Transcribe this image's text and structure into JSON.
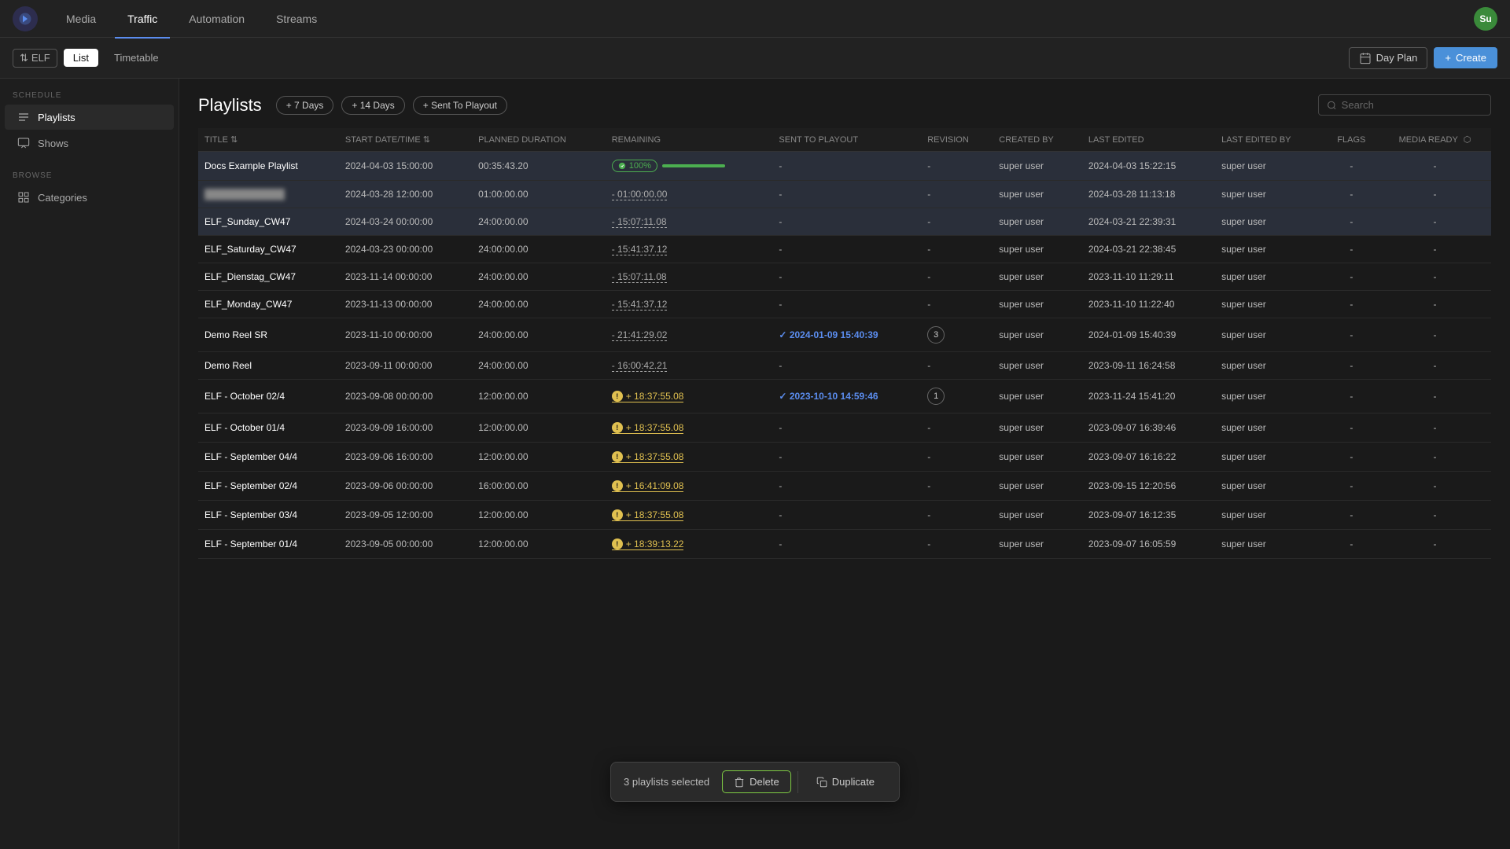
{
  "app": {
    "logo_text": "N"
  },
  "nav": {
    "items": [
      {
        "label": "Media",
        "active": false
      },
      {
        "label": "Traffic",
        "active": true
      },
      {
        "label": "Automation",
        "active": false
      },
      {
        "label": "Streams",
        "active": false
      }
    ],
    "user_initials": "Su",
    "user_bg": "#3a8a3a"
  },
  "toolbar": {
    "elf_label": "ELF",
    "list_label": "List",
    "timetable_label": "Timetable",
    "day_plan_label": "Day Plan",
    "create_label": "+ Create"
  },
  "sidebar": {
    "schedule_label": "SCHEDULE",
    "playlists_label": "Playlists",
    "shows_label": "Shows",
    "browse_label": "BROWSE",
    "categories_label": "Categories"
  },
  "playlists": {
    "title": "Playlists",
    "btn_7days": "+ 7 Days",
    "btn_14days": "+ 14 Days",
    "btn_sent": "+ Sent To Playout",
    "search_placeholder": "Search"
  },
  "table": {
    "columns": [
      "TITLE",
      "START DATE/TIME",
      "PLANNED DURATION",
      "REMAINING",
      "SENT TO PLAYOUT",
      "REVISION",
      "CREATED BY",
      "LAST EDITED",
      "LAST EDITED BY",
      "FLAGS",
      "MEDIA READY"
    ],
    "rows": [
      {
        "title": "Docs Example Playlist",
        "start": "2024-04-03 15:00:00",
        "planned": "00:35:43.20",
        "remaining_type": "progress",
        "remaining_pct": 100,
        "remaining_label": "100%",
        "sent_to_playout": "-",
        "revision": "-",
        "created_by": "super user",
        "last_edited": "2024-04-03 15:22:15",
        "last_edited_by": "super user",
        "flags": "-",
        "media_ready": "-",
        "selected": true
      },
      {
        "title": "",
        "title_blurred": true,
        "start": "2024-03-28 12:00:00",
        "planned": "01:00:00.00",
        "remaining_type": "undertime",
        "remaining_label": "- 01:00:00.00",
        "sent_to_playout": "-",
        "revision": "-",
        "created_by": "super user",
        "last_edited": "2024-03-28 11:13:18",
        "last_edited_by": "super user",
        "flags": "-",
        "media_ready": "-",
        "selected": true
      },
      {
        "title": "ELF_Sunday_CW47",
        "start": "2024-03-24 00:00:00",
        "planned": "24:00:00.00",
        "remaining_type": "undertime",
        "remaining_label": "- 15:07:11.08",
        "sent_to_playout": "-",
        "revision": "-",
        "created_by": "super user",
        "last_edited": "2024-03-21 22:39:31",
        "last_edited_by": "super user",
        "flags": "-",
        "media_ready": "-",
        "selected": true
      },
      {
        "title": "ELF_Saturday_CW47",
        "start": "2024-03-23 00:00:00",
        "planned": "24:00:00.00",
        "remaining_type": "undertime",
        "remaining_label": "- 15:41:37.12",
        "sent_to_playout": "-",
        "revision": "-",
        "created_by": "super user",
        "last_edited": "2024-03-21 22:38:45",
        "last_edited_by": "super user",
        "flags": "-",
        "media_ready": "-",
        "selected": false
      },
      {
        "title": "ELF_Dienstag_CW47",
        "start": "2023-11-14 00:00:00",
        "planned": "24:00:00.00",
        "remaining_type": "undertime",
        "remaining_label": "- 15:07:11.08",
        "sent_to_playout": "-",
        "revision": "-",
        "created_by": "super user",
        "last_edited": "2023-11-10 11:29:11",
        "last_edited_by": "super user",
        "flags": "-",
        "media_ready": "-",
        "selected": false
      },
      {
        "title": "ELF_Monday_CW47",
        "start": "2023-11-13 00:00:00",
        "planned": "24:00:00.00",
        "remaining_type": "undertime",
        "remaining_label": "- 15:41:37.12",
        "sent_to_playout": "-",
        "revision": "-",
        "created_by": "super user",
        "last_edited": "2023-11-10 11:22:40",
        "last_edited_by": "super user",
        "flags": "-",
        "media_ready": "-",
        "selected": false
      },
      {
        "title": "Demo Reel SR",
        "start": "2023-11-10 00:00:00",
        "planned": "24:00:00.00",
        "remaining_type": "overtime",
        "remaining_label": "- 21:41:29.02",
        "sent_to_playout": "2024-01-09 15:40:39",
        "sent_check": true,
        "revision": "3",
        "revision_type": "badge",
        "created_by": "super user",
        "last_edited": "2024-01-09 15:40:39",
        "last_edited_by": "super user",
        "flags": "-",
        "media_ready": "-",
        "selected": false
      },
      {
        "title": "Demo Reel",
        "start": "2023-09-11 00:00:00",
        "planned": "24:00:00.00",
        "remaining_type": "overtime_plain",
        "remaining_label": "- 16:00:42.21",
        "sent_to_playout": "-",
        "revision": "-",
        "created_by": "super user",
        "last_edited": "2023-09-11 16:24:58",
        "last_edited_by": "super user",
        "flags": "-",
        "media_ready": "-",
        "selected": false
      },
      {
        "title": "ELF - October 02/4",
        "start": "2023-09-08 00:00:00",
        "planned": "12:00:00.00",
        "remaining_type": "overtime_yellow",
        "remaining_label": "+ 18:37:55.08",
        "sent_to_playout": "2023-10-10 14:59:46",
        "sent_check": true,
        "revision": "1",
        "revision_type": "badge",
        "created_by": "super user",
        "last_edited": "2023-11-24 15:41:20",
        "last_edited_by": "super user",
        "flags": "-",
        "media_ready": "-",
        "selected": false
      },
      {
        "title": "ELF - October 01/4",
        "start": "2023-09-09 16:00:00",
        "planned": "12:00:00.00",
        "remaining_type": "overtime_yellow",
        "remaining_label": "+ 18:37:55.08",
        "sent_to_playout": "-",
        "revision": "-",
        "created_by": "super user",
        "last_edited": "2023-09-07 16:39:46",
        "last_edited_by": "super user",
        "flags": "-",
        "media_ready": "-",
        "selected": false
      },
      {
        "title": "ELF - September 04/4",
        "start": "2023-09-06 16:00:00",
        "planned": "12:00:00.00",
        "remaining_type": "overtime_yellow",
        "remaining_label": "+ 18:37:55.08",
        "sent_to_playout": "-",
        "revision": "-",
        "created_by": "super user",
        "last_edited": "2023-09-07 16:16:22",
        "last_edited_by": "super user",
        "flags": "-",
        "media_ready": "-",
        "selected": false
      },
      {
        "title": "ELF - September 02/4",
        "start": "2023-09-06 00:00:00",
        "planned": "16:00:00.00",
        "remaining_type": "overtime_yellow",
        "remaining_label": "+ 16:41:09.08",
        "sent_to_playout": "-",
        "revision": "-",
        "created_by": "super user",
        "last_edited": "2023-09-15 12:20:56",
        "last_edited_by": "super user",
        "flags": "-",
        "media_ready": "-",
        "selected": false
      },
      {
        "title": "ELF - September 03/4",
        "start": "2023-09-05 12:00:00",
        "planned": "12:00:00.00",
        "remaining_type": "overtime_yellow",
        "remaining_label": "+ 18:37:55.08",
        "sent_to_playout": "-",
        "revision": "-",
        "created_by": "super user",
        "last_edited": "2023-09-07 16:12:35",
        "last_edited_by": "super user",
        "flags": "-",
        "media_ready": "-",
        "selected": false
      },
      {
        "title": "ELF - September 01/4",
        "start": "2023-09-05 00:00:00",
        "planned": "12:00:00.00",
        "remaining_type": "overtime_yellow",
        "remaining_label": "+ 18:39:13.22",
        "sent_to_playout": "-",
        "revision": "-",
        "created_by": "super user",
        "last_edited": "2023-09-07 16:05:59",
        "last_edited_by": "super user",
        "flags": "-",
        "media_ready": "-",
        "selected": false
      }
    ]
  },
  "bottom_bar": {
    "selected_text": "3 playlists selected",
    "delete_label": "Delete",
    "duplicate_label": "Duplicate"
  }
}
